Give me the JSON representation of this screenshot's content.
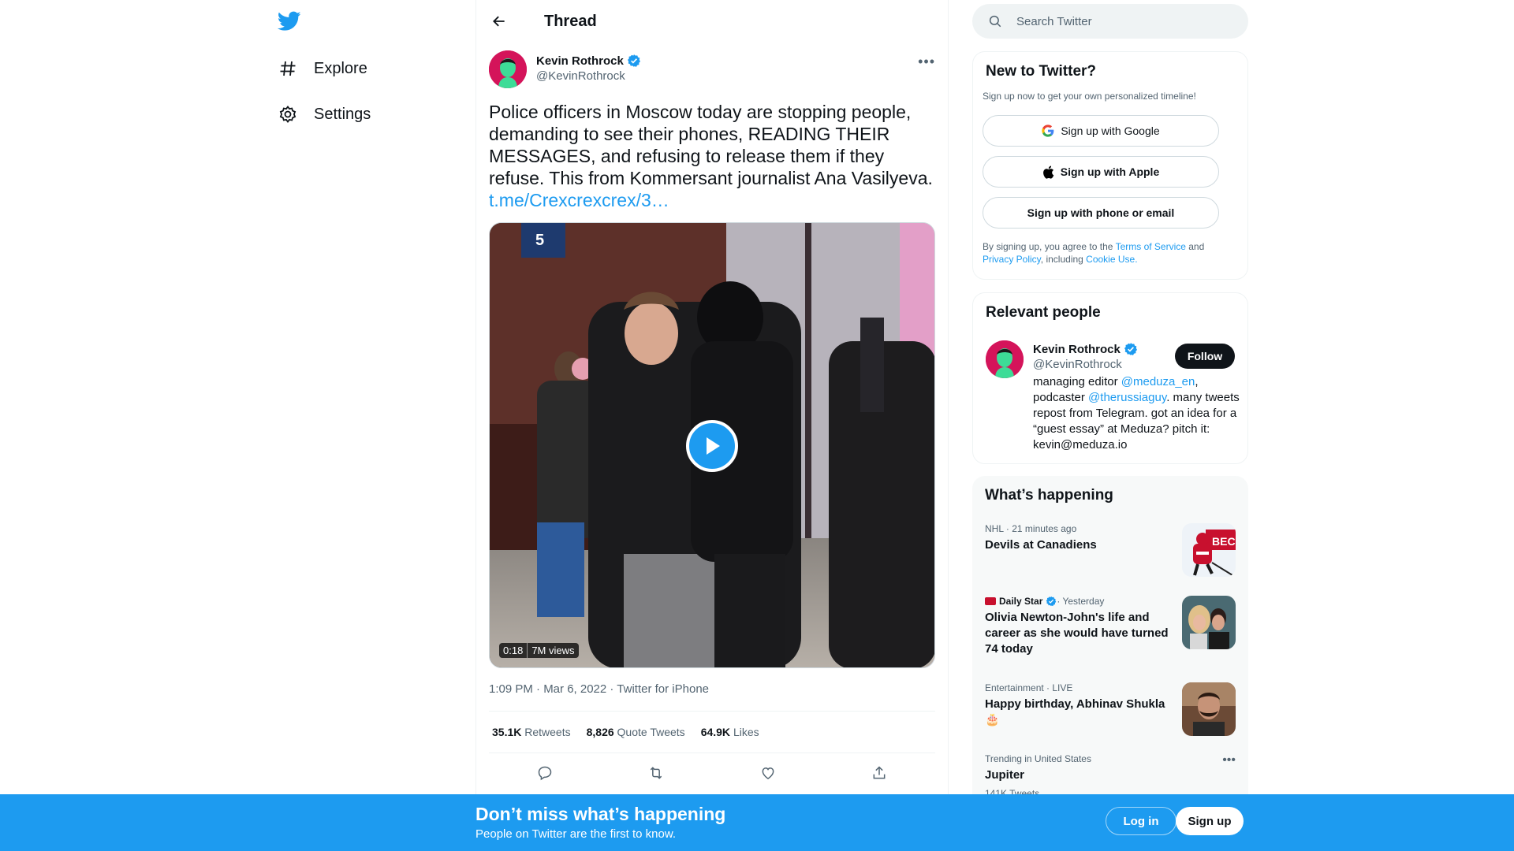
{
  "nav": {
    "items": [
      {
        "label": "Explore",
        "icon": "hashtag-icon"
      },
      {
        "label": "Settings",
        "icon": "gear-icon"
      }
    ]
  },
  "thread": {
    "title": "Thread",
    "author": {
      "name": "Kevin Rothrock",
      "handle": "@KevinRothrock"
    },
    "text": "Police officers in Moscow today are stopping people, demanding to see their phones, READING THEIR MESSAGES, and refusing to release them if they refuse. This from Kommersant journalist Ana Vasilyeva.",
    "link": "t.me/Crexcrexcrex/3…",
    "video": {
      "duration": "0:18",
      "views": "7M views"
    },
    "timestamp": "1:09 PM · Mar 6, 2022 · Twitter for iPhone",
    "stats": {
      "retweets": {
        "value": "35.1K",
        "label": "Retweets"
      },
      "quotes": {
        "value": "8,826",
        "label": "Quote Tweets"
      },
      "likes": {
        "value": "64.9K",
        "label": "Likes"
      }
    }
  },
  "search": {
    "placeholder": "Search Twitter"
  },
  "new_to_twitter": {
    "title": "New to Twitter?",
    "subtitle": "Sign up now to get your own personalized timeline!",
    "google": "Sign up with Google",
    "apple": "Sign up with Apple",
    "phone": "Sign up with phone or email",
    "legal_prefix": "By signing up, you agree to the ",
    "terms": "Terms of Service",
    "and": " and ",
    "privacy": "Privacy Policy",
    "including": ", including ",
    "cookie": "Cookie Use."
  },
  "relevant": {
    "title": "Relevant people",
    "name": "Kevin Rothrock",
    "handle": "@KevinRothrock",
    "follow": "Follow",
    "bio": {
      "p1": "managing editor ",
      "m1": "@meduza_en",
      "p2": ", podcaster ",
      "m2": "@therussiaguy",
      "p3": ". many tweets repost from Telegram. got an idea for a “guest essay” at Meduza? pitch it: kevin@meduza.io"
    }
  },
  "happening": {
    "title": "What’s happening",
    "trends": [
      {
        "meta": "NHL · 21 minutes ago",
        "title": "Devils at Canadiens"
      },
      {
        "source": "Daily Star",
        "time": " · Yesterday",
        "title": "Olivia Newton-John's life and career as she would have turned 74 today"
      },
      {
        "meta": "Entertainment · LIVE",
        "title": "Happy birthday, Abhinav Shukla 🎂"
      },
      {
        "meta": "Trending in United States",
        "title": "Jupiter",
        "count": "141K Tweets"
      }
    ]
  },
  "banner": {
    "heading": "Don’t miss what’s happening",
    "sub": "People on Twitter are the first to know.",
    "login": "Log in",
    "signup": "Sign up"
  },
  "colors": {
    "accent": "#1d9bf0",
    "text": "#0f1419",
    "muted": "#536471"
  }
}
